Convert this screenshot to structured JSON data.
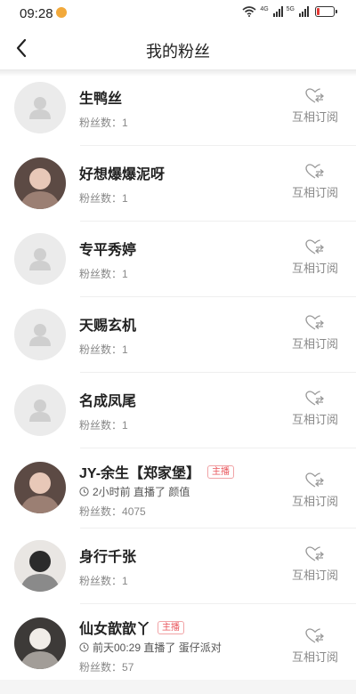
{
  "status_bar": {
    "time": "09:28",
    "net_left": "4G",
    "net_right": "5G",
    "battery_level": 0.15
  },
  "header": {
    "title": "我的粉丝"
  },
  "fans_label": "粉丝数：",
  "follow_label": "互相订阅",
  "host_badge": "主播",
  "fans": [
    {
      "name": "生鸭丝",
      "fans_count": "1",
      "avatar": "default"
    },
    {
      "name": "好想爆爆泥呀",
      "fans_count": "1",
      "avatar": "photo"
    },
    {
      "name": "专平秀婷",
      "fans_count": "1",
      "avatar": "default"
    },
    {
      "name": "天赐玄机",
      "fans_count": "1",
      "avatar": "default"
    },
    {
      "name": "名成凤尾",
      "fans_count": "1",
      "avatar": "default"
    },
    {
      "name": "JY-余生【郑家堡】",
      "fans_count": "4075",
      "avatar": "photo",
      "is_host": true,
      "live_info": "2小时前 直播了 颜值"
    },
    {
      "name": "身行千张",
      "fans_count": "1",
      "avatar": "photo"
    },
    {
      "name": "仙女歆歆丫",
      "fans_count": "57",
      "avatar": "photo",
      "is_host": true,
      "live_info": "前天00:29 直播了 蛋仔派对"
    }
  ],
  "colors": {
    "host_badge": "#e9575d",
    "battery_low": "#e53935",
    "avatar_bg": "#ebebeb"
  }
}
